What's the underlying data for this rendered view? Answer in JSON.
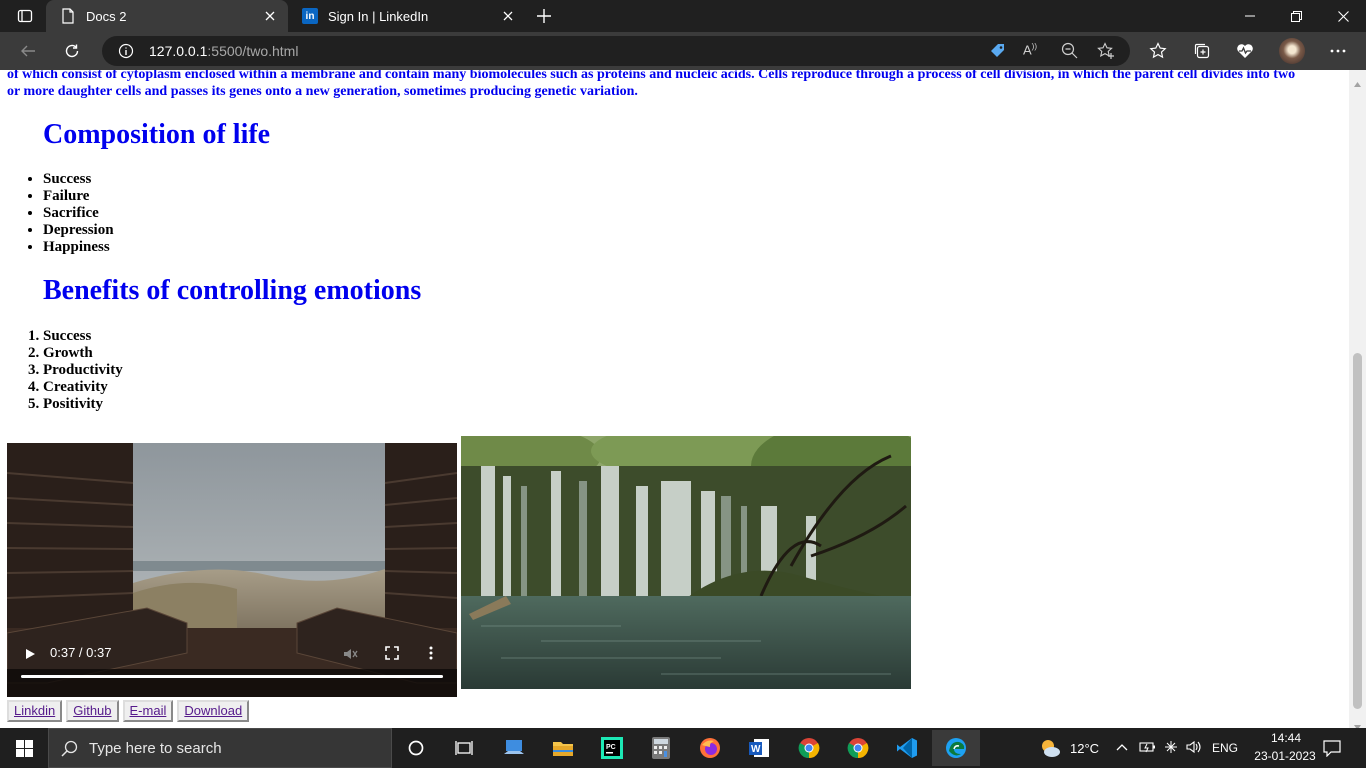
{
  "browser": {
    "tabs": [
      {
        "title": "Docs 2",
        "active": true
      },
      {
        "title": "Sign In | LinkedIn",
        "active": false
      }
    ],
    "address": {
      "host": "127.0.0.1",
      "path": ":5500/two.html"
    }
  },
  "page": {
    "intro_line1": "of which consist of cytoplasm enclosed within a membrane and contain many biomolecules such as proteins and nucleic acids. Cells reproduce through a process of cell division, in which the parent cell divides into two",
    "intro_line2": "or more daughter cells and passes its genes onto a new generation, sometimes producing genetic variation.",
    "heading1": "Composition of life",
    "list1": [
      "Success",
      "Failure",
      "Sacrifice",
      "Depression",
      "Happiness"
    ],
    "heading2": "Benefits of controlling emotions",
    "list2": [
      "Success",
      "Growth",
      "Productivity",
      "Creativity",
      "Positivity"
    ],
    "video": {
      "time": "0:37 / 0:37",
      "progress": 1.0
    },
    "links": [
      "Linkdin",
      "Github",
      "E-mail",
      "Download"
    ]
  },
  "taskbar": {
    "search_placeholder": "Type here to search",
    "weather": "12°C",
    "language": "ENG",
    "time": "14:44",
    "date": "23-01-2023"
  },
  "colors": {
    "heading": "#0000ee",
    "titlebar": "#202020",
    "toolbar": "#3b3b3b",
    "taskbar": "#1f1f1f"
  }
}
